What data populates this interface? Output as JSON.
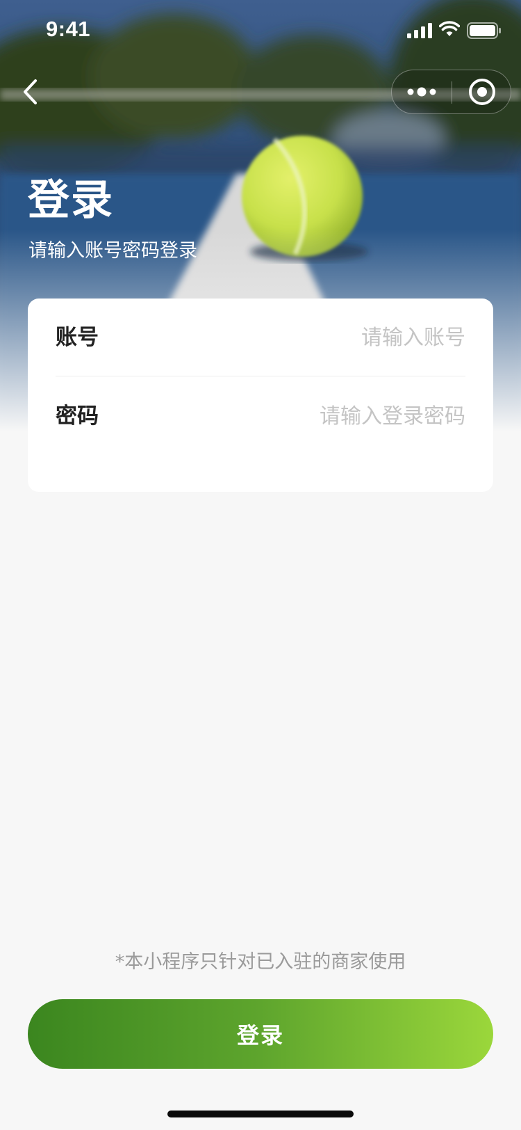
{
  "status_bar": {
    "time": "9:41"
  },
  "header": {
    "title": "登录",
    "subtitle": "请输入账号密码登录"
  },
  "form": {
    "account": {
      "label": "账号",
      "value": "",
      "placeholder": "请输入账号"
    },
    "password": {
      "label": "密码",
      "value": "",
      "placeholder": "请输入登录密码"
    }
  },
  "footer": {
    "disclaimer": "*本小程序只针对已入驻的商家使用",
    "login_label": "登录"
  },
  "icons": {
    "back": "chevron-left-icon",
    "more": "more-dots-icon",
    "close": "target-circle-icon",
    "signal": "signal-icon",
    "wifi": "wifi-icon",
    "battery": "battery-icon"
  },
  "colors": {
    "accent_start": "#3b861f",
    "accent_end": "#9bd73b",
    "background": "#f7f7f7",
    "placeholder": "#c4c4c4",
    "label": "#222222"
  }
}
